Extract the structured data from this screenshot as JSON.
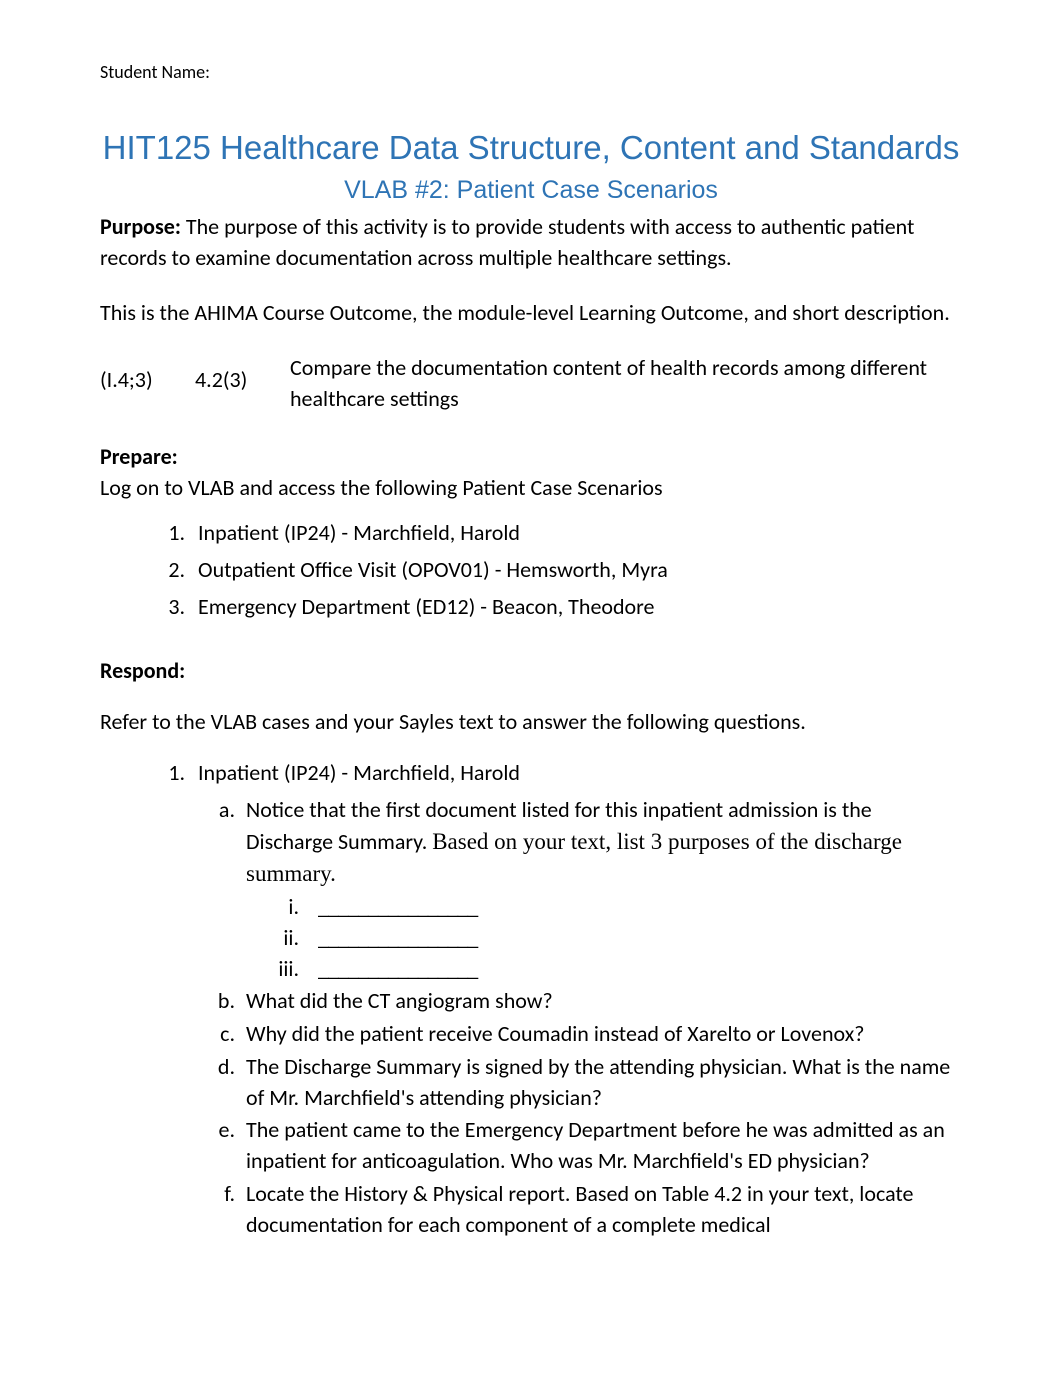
{
  "header": {
    "student_label": "Student Name:"
  },
  "title": "HIT125 Healthcare Data Structure, Content and Standards",
  "subtitle": "VLAB #2: Patient Case Scenarios",
  "purpose": {
    "label": "Purpose:",
    "text": " The purpose of this activity is to provide students with access to authentic patient records to examine documentation across multiple healthcare settings."
  },
  "outcome_intro": "This is the AHIMA Course Outcome, the module-level Learning Outcome, and short description.",
  "outcome": {
    "col1": "(I.4;3)",
    "col2": "4.2(3)",
    "col3": "Compare the documentation content of health records among different healthcare settings"
  },
  "prepare": {
    "label": "Prepare:",
    "text": "Log on to VLAB and access the following Patient Case Scenarios",
    "items": [
      "Inpatient (IP24) - Marchfield, Harold",
      "Outpatient Office Visit (OPOV01) - Hemsworth, Myra",
      "Emergency Department (ED12) - Beacon, Theodore"
    ]
  },
  "respond": {
    "label": "Respond:",
    "intro": "Refer to the VLAB cases and your Sayles text to answer the following questions.",
    "q1": {
      "heading": "Inpatient (IP24) - Marchfield, Harold",
      "a_part1": "Notice that the first document listed for this inpatient admission is the Discharge Summary. ",
      "a_part2": "Based on your text, list 3 purposes of the discharge summary.",
      "blank": "________________",
      "b": "What did the CT angiogram show?",
      "c": "Why did the patient receive Coumadin instead of Xarelto or Lovenox?",
      "d": "The Discharge Summary is signed by the attending physician.  What is the name of Mr. Marchfield's attending physician?",
      "e": "The patient came to the Emergency Department before he was admitted as an inpatient for anticoagulation. Who was Mr. Marchfield's ED physician?",
      "f": "Locate the History & Physical report. Based on Table 4.2 in your text, locate documentation for each component  of a complete medical"
    }
  }
}
